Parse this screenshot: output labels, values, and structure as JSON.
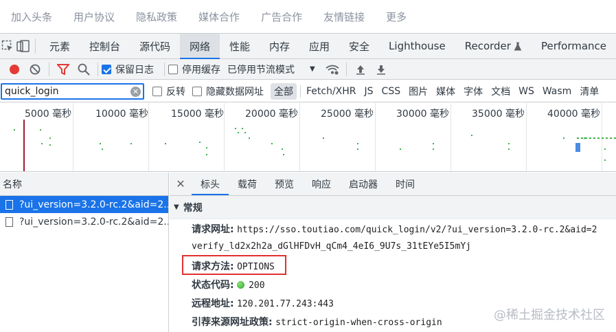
{
  "site_nav": [
    "加入头条",
    "用户协议",
    "隐私政策",
    "媒体合作",
    "广告合作",
    "友情链接",
    "更多"
  ],
  "devtools": {
    "tabs": [
      "元素",
      "控制台",
      "源代码",
      "网络",
      "性能",
      "内存",
      "应用",
      "安全",
      "Lighthouse",
      "Recorder",
      "Performance"
    ],
    "active_tab": "网络"
  },
  "network_toolbar": {
    "preserve_log": "保留日志",
    "disable_cache": "停用缓存",
    "throttling": "已停用节流模式"
  },
  "filter": {
    "value": "quick_login",
    "invert": "反转",
    "hide_data_urls": "隐藏数据网址",
    "types": [
      "全部",
      "Fetch/XHR",
      "JS",
      "CSS",
      "图片",
      "媒体",
      "字体",
      "文档",
      "WS",
      "Wasm",
      "清单"
    ]
  },
  "timeline": {
    "labels": [
      "5000 毫秒",
      "10000 毫秒",
      "15000 毫秒",
      "20000 毫秒",
      "25000 毫秒",
      "30000 毫秒",
      "35000 毫秒",
      "40000 毫秒"
    ]
  },
  "request_list": {
    "header": "名称",
    "items": [
      "?ui_version=3.2.0-rc.2&aid=2...",
      "?ui_version=3.2.0-rc.2&aid=2..."
    ]
  },
  "details": {
    "tabs": [
      "标头",
      "载荷",
      "预览",
      "响应",
      "启动器",
      "时间"
    ],
    "section": "常规",
    "request_url_label": "请求网址:",
    "request_url": "https://sso.toutiao.com/quick_login/v2/?ui_version=3.2.0-rc.2&aid=2",
    "request_url_cont": "verify_ld2x2h2a_dGlHFDvH_qCm4_4eI6_9U7s_31tEYe5I5mYj",
    "method_label": "请求方法:",
    "method": "OPTIONS",
    "status_label": "状态代码:",
    "status": "200",
    "remote_label": "远程地址:",
    "remote": "120.201.77.243:443",
    "referrer_label": "引荐来源网址政策:",
    "referrer": "strict-origin-when-cross-origin"
  },
  "watermark": "@稀土掘金技术社区",
  "colors": {
    "accent": "#1a73e8",
    "highlight_box": "#e0302f",
    "record": "#e53935",
    "status_ok": "#2ea52a"
  }
}
